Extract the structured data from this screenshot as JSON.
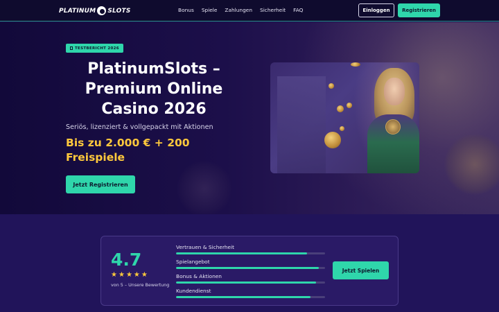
{
  "header": {
    "logo_left": "PLATINUM",
    "logo_right": "SLOTS",
    "nav": [
      "Bonus",
      "Spiele",
      "Zahlungen",
      "Sicherheit",
      "FAQ"
    ],
    "login_label": "Einloggen",
    "register_label": "Registrieren"
  },
  "hero": {
    "badge": "TESTBERICHT 2026",
    "title_lines": [
      "PlatinumSlots –",
      "Premium Online",
      "Casino 2026"
    ],
    "subtitle": "Seriös, lizenziert & vollgepackt mit Aktionen",
    "offer_lines": [
      "Bis zu 2.000 € + 200",
      "Freispiele"
    ],
    "cta_label": "Jetzt Registrieren"
  },
  "rating": {
    "score": "4.7",
    "stars": 5,
    "caption": "von 5 – Unsere Bewertung",
    "criteria": [
      {
        "label": "Vertrauen & Sicherheit",
        "fill": 0.88
      },
      {
        "label": "Spielangebot",
        "fill": 0.96
      },
      {
        "label": "Bonus & Aktionen",
        "fill": 0.94
      },
      {
        "label": "Kundendienst",
        "fill": 0.9
      }
    ],
    "play_label": "Jetzt Spielen"
  },
  "colors": {
    "accent": "#2fd6ab",
    "gold": "#ffc93c",
    "header_bg": "#0f0b2e",
    "section_bg": "#21145a",
    "card_bg": "#2a1a66"
  }
}
